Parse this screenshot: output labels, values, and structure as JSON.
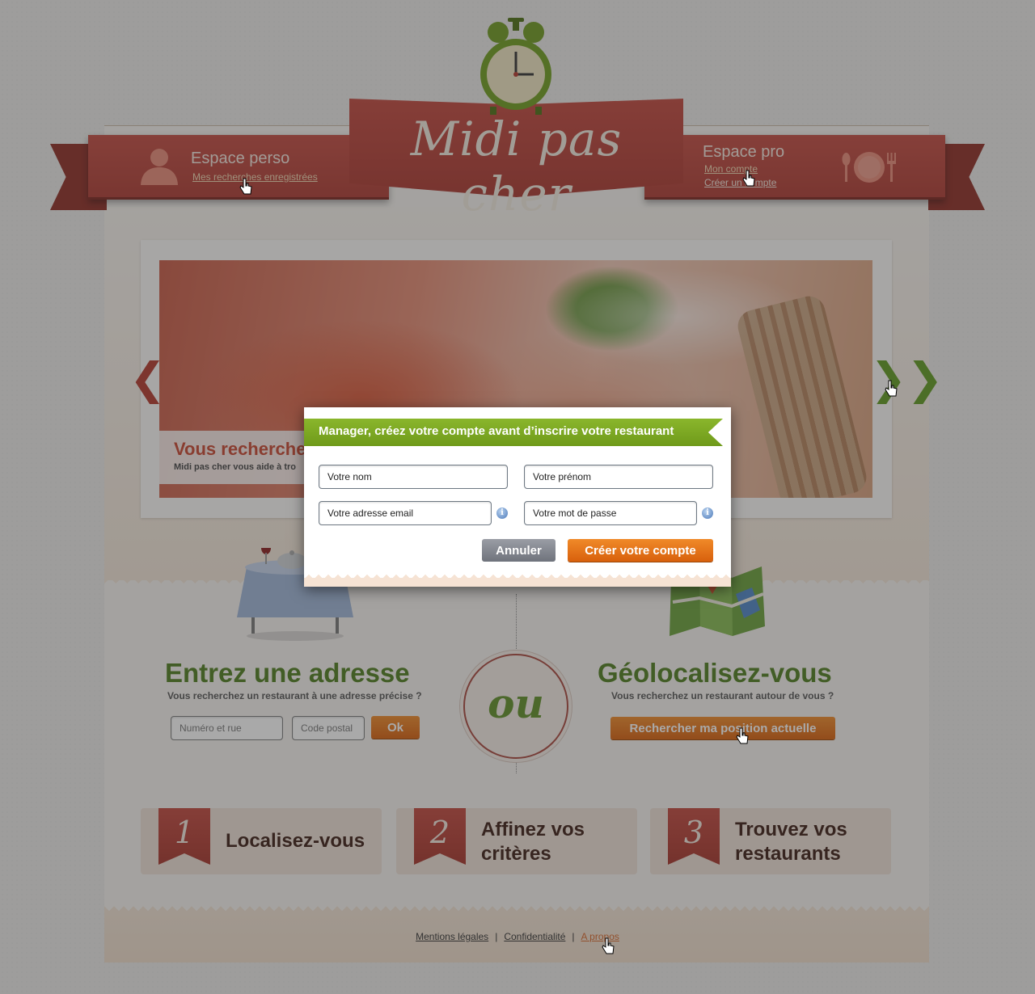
{
  "header": {
    "brand": "Midi pas cher",
    "espace_perso": {
      "title": "Espace perso",
      "link": "Mes recherches enregistrées"
    },
    "espace_pro": {
      "title": "Espace pro",
      "links": [
        "Mon compte",
        "Créer un compte"
      ]
    }
  },
  "slider": {
    "caption_title": "Vous recherche",
    "caption_text": "Midi pas cher vous aide à tro",
    "prev_glyph": "❮",
    "next_glyph": "❯❯"
  },
  "search": {
    "address": {
      "title": "Entrez une adresse",
      "subtitle": "Vous recherchez un restaurant à une adresse précise ?",
      "street_placeholder": "Numéro et rue",
      "postal_placeholder": "Code postal",
      "ok_label": "Ok"
    },
    "separator": "ou",
    "geo": {
      "title": "Géolocalisez-vous",
      "subtitle": "Vous recherchez un restaurant autour de vous ?",
      "button_label": "Rechercher ma position actuelle"
    }
  },
  "steps": [
    {
      "number": "1",
      "label": "Localisez-vous"
    },
    {
      "number": "2",
      "label_line1": "Affinez vos",
      "label_line2": "critères"
    },
    {
      "number": "3",
      "label_line1": "Trouvez vos",
      "label_line2": "restaurants"
    }
  ],
  "footer": {
    "links": [
      "Mentions légales",
      "Confidentialité",
      "A propos"
    ],
    "separator": "|"
  },
  "modal": {
    "title": "Manager, créez votre compte avant d’inscrire votre restaurant",
    "fields": {
      "nom": "Votre nom",
      "prenom": "Votre prénom",
      "email": "Votre adresse email",
      "password": "Votre mot de passe"
    },
    "info_glyph": "i",
    "cancel_label": "Annuler",
    "submit_label": "Créer votre compte"
  },
  "colors": {
    "brand_red": "#b3382c",
    "brand_green": "#5f9a1f",
    "accent_orange": "#e8701a"
  },
  "icons": [
    "user-icon",
    "cutlery-plate-icon",
    "alarm-clock-icon",
    "table-illustration",
    "map-icon",
    "info-icon",
    "hand-cursor-icon"
  ]
}
